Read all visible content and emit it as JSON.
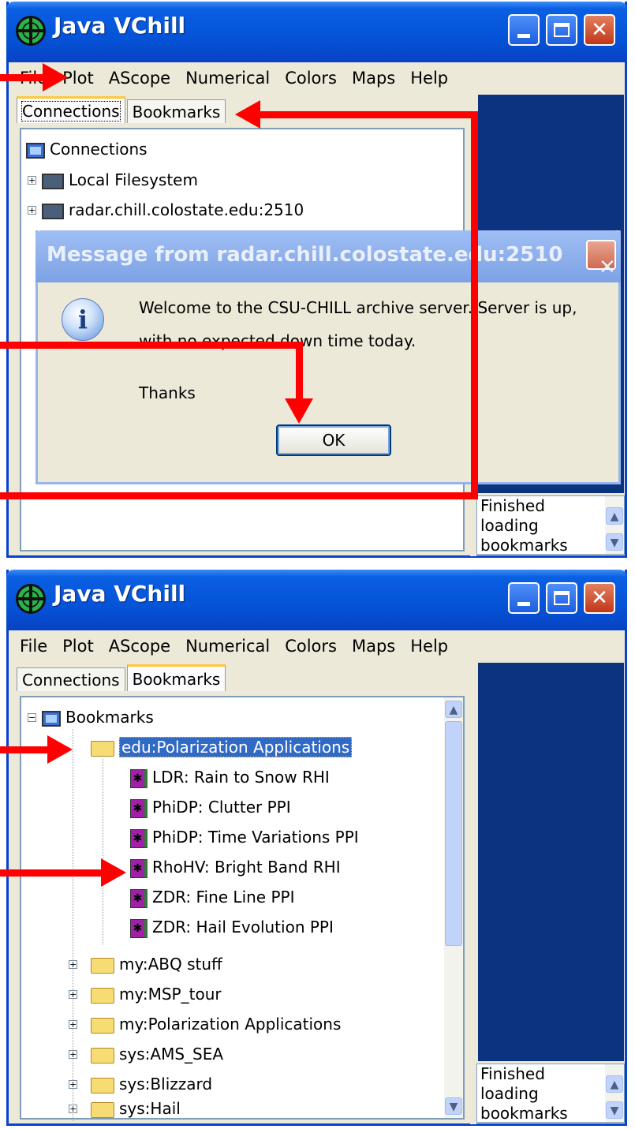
{
  "window1": {
    "title": "Java VChill",
    "menu": [
      "File",
      "Plot",
      "AScope",
      "Numerical",
      "Colors",
      "Maps",
      "Help"
    ],
    "tabs": [
      "Connections",
      "Bookmarks"
    ],
    "tree": {
      "root": "Connections",
      "items": [
        "Local Filesystem",
        "radar.chill.colostate.edu:2510"
      ]
    },
    "status": [
      "Finished",
      "loading",
      "bookmarks"
    ],
    "dialog": {
      "title": "Message from radar.chill.colostate.edu:2510",
      "line1": "Welcome to the CSU-CHILL archive server. Server is up,",
      "line2": "with no expected down time today.",
      "line3": "Thanks",
      "ok_label": "OK"
    }
  },
  "window2": {
    "title": "Java VChill",
    "menu": [
      "File",
      "Plot",
      "AScope",
      "Numerical",
      "Colors",
      "Maps",
      "Help"
    ],
    "tabs": [
      "Connections",
      "Bookmarks"
    ],
    "tree": {
      "root": "Bookmarks",
      "expanded_folder": "edu:Polarization Applications",
      "bookmarks": [
        "LDR: Rain to Snow RHI",
        "PhiDP: Clutter PPI",
        "PhiDP: Time Variations PPI",
        "RhoHV: Bright Band RHI",
        "ZDR: Fine Line PPI",
        "ZDR: Hail Evolution PPI"
      ],
      "folders": [
        "my:ABQ stuff",
        "my:MSP_tour",
        "my:Polarization Applications",
        "sys:AMS_SEA",
        "sys:Blizzard",
        "sys:Hail"
      ]
    },
    "status": [
      "Finished",
      "loading",
      "bookmarks"
    ]
  }
}
